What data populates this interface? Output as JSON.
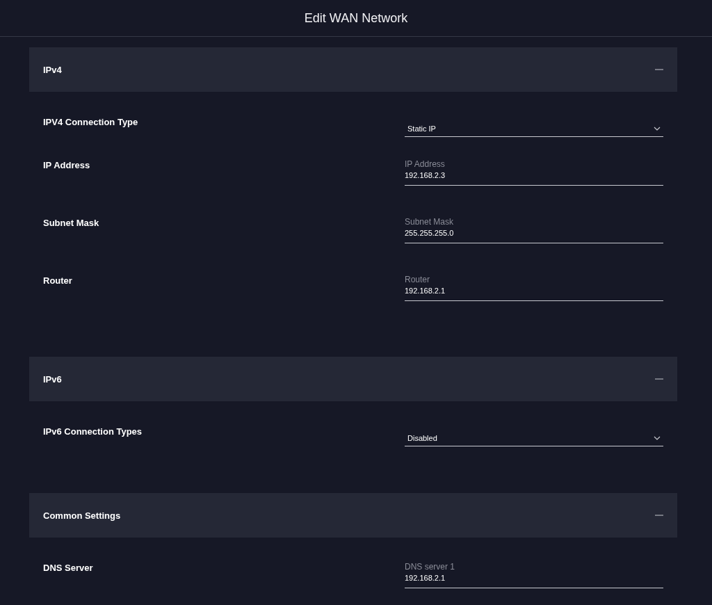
{
  "window": {
    "title": "Edit WAN Network"
  },
  "sections": [
    {
      "title": "IPv4",
      "expanded": true,
      "rows": [
        {
          "kind": "select",
          "label": "IPV4 Connection Type",
          "value": "Static IP"
        },
        {
          "kind": "text",
          "label": "IP Address",
          "field_label": "IP Address",
          "value": "192.168.2.3"
        },
        {
          "kind": "text",
          "label": "Subnet Mask",
          "field_label": "Subnet Mask",
          "value": "255.255.255.0"
        },
        {
          "kind": "text",
          "label": "Router",
          "field_label": "Router",
          "value": "192.168.2.1"
        }
      ]
    },
    {
      "title": "IPv6",
      "expanded": true,
      "rows": [
        {
          "kind": "select",
          "label": "IPv6 Connection Types",
          "value": "Disabled"
        }
      ]
    },
    {
      "title": "Common Settings",
      "expanded": true,
      "rows": [
        {
          "kind": "text",
          "label": "DNS Server",
          "field_label": "DNS server 1",
          "value": "192.168.2.1"
        }
      ]
    }
  ]
}
